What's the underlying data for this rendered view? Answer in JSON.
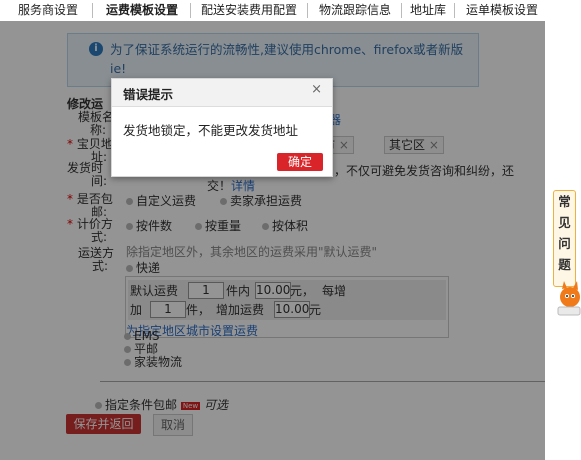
{
  "tabs": [
    {
      "label": "服务商设置"
    },
    {
      "label": "运费模板设置"
    },
    {
      "label": "配送安装费用配置"
    },
    {
      "label": "物流跟踪信息"
    },
    {
      "label": "地址库"
    },
    {
      "label": "运单模板设置"
    }
  ],
  "notice": {
    "text": "为了保证系统运行的流畅性,建议使用chrome、firefox或者新版ie!"
  },
  "form": {
    "section_title": "修改运",
    "name_label": "模板名称:",
    "name_label_line1": "模板名",
    "name_label_line2": "称:",
    "link_text": "计算器",
    "ship_from_label_line1": "宝贝地",
    "ship_from_label_line2": "址:",
    "city_chip": "市",
    "district_chip": "其它区",
    "time_label_line1": "发货时",
    "time_label_line2": "间:",
    "time_desc": "时间，不仅可避免发货咨询和纠纷，还",
    "time_desc2": "交！",
    "detail_link": "详情",
    "free_shipping_label_line1": "是否包",
    "free_shipping_label_line2": "邮:",
    "free_options": [
      "自定义运费",
      "卖家承担运费"
    ],
    "pricing_label_line1": "计价方",
    "pricing_label_line2": "式:",
    "pricing_options": [
      "按件数",
      "按重量",
      "按体积"
    ],
    "delivery_label_line1": "运送方",
    "delivery_label_line2": "式:",
    "delivery_hint": "除指定地区外，其余地区的运费采用\"默认运费\"",
    "express": "快递",
    "default_fee_label": "默认运费",
    "default_qty": "1",
    "unit_within": "件内",
    "default_price": "10.00",
    "yuan": "元，",
    "each_add": "每增",
    "add_label": "加",
    "add_qty": "1",
    "unit_piece": "件，",
    "add_fee_label": "增加运费",
    "add_price": "10.00",
    "yuan2": "元",
    "set_city_link": "为指定地区城市设置运费",
    "other_methods": [
      "EMS",
      "平邮",
      "家装物流"
    ],
    "conditional_label": "指定条件包邮",
    "new_badge": "New",
    "optional": "可选",
    "save_button": "保存并返回",
    "cancel_button": "取消"
  },
  "modal": {
    "title": "错误提示",
    "close": "×",
    "message": "发货地锁定，不能更改发货地址",
    "ok": "确定"
  },
  "help_tab": {
    "chars": [
      "常",
      "见",
      "问",
      "题"
    ]
  },
  "colors": {
    "accent_red": "#d9242a",
    "link_blue": "#2d6ec9",
    "notice_bg": "#eaf4fb"
  }
}
